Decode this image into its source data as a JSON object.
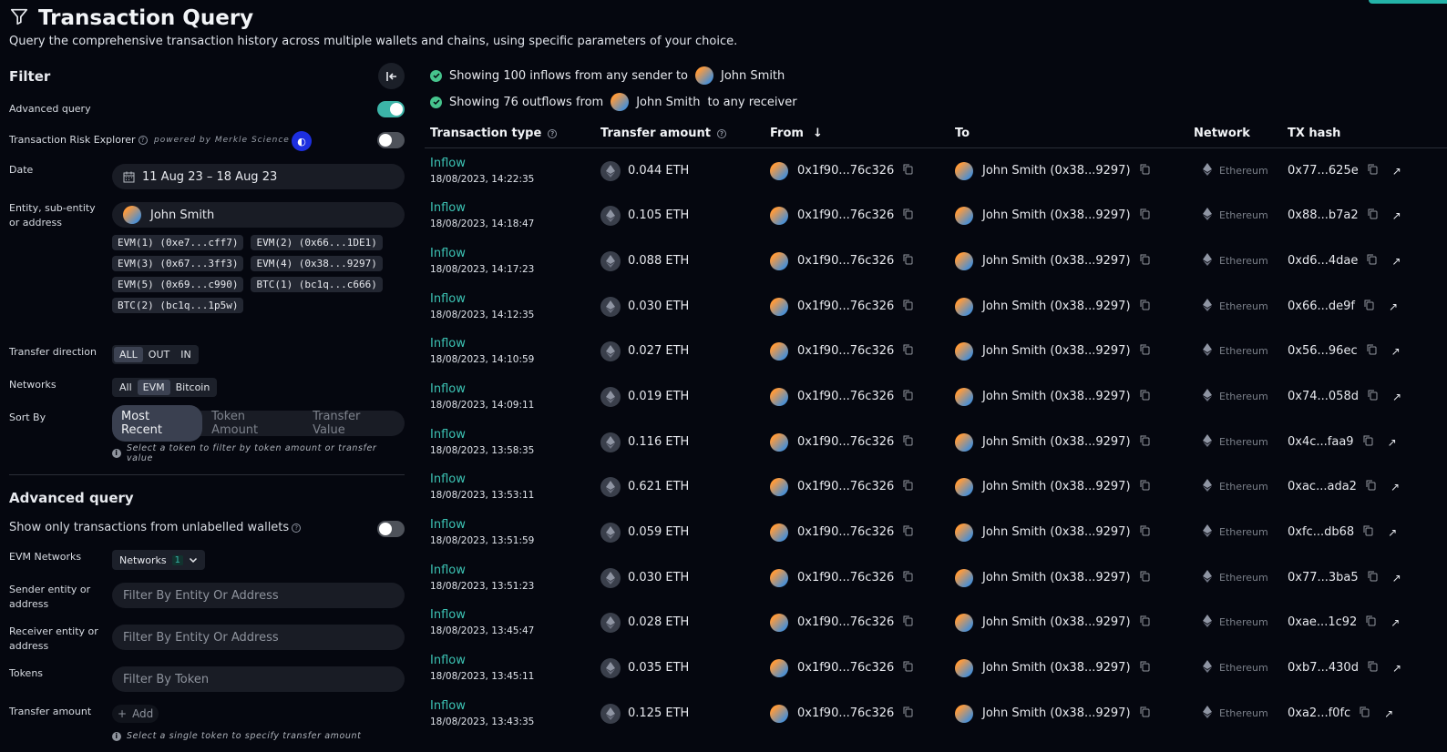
{
  "header": {
    "title": "Transaction Query",
    "subtitle": "Query the comprehensive transaction history across multiple wallets and chains, using specific parameters of your choice."
  },
  "filter": {
    "title": "Filter",
    "advanced_query_label": "Advanced query",
    "advanced_query_on": true,
    "risk_explorer_label": "Transaction Risk Explorer",
    "risk_explorer_on": false,
    "powered_by": "powered by Merkle Science",
    "date_label": "Date",
    "date_value": "11 Aug 23 – 18 Aug 23",
    "entity_label_line1": "Entity, sub-entity",
    "entity_label_line2": "or address",
    "entity_value": "John Smith",
    "chips": [
      "EVM(1) (0xe7...cff7)",
      "EVM(2) (0x66...1DE1)",
      "EVM(3) (0x67...3ff3)",
      "EVM(4) (0x38...9297)",
      "EVM(5) (0x69...c990)",
      "BTC(1) (bc1q...c666)",
      "BTC(2) (bc1q...1p5w)"
    ],
    "direction_label": "Transfer direction",
    "direction_options": [
      "ALL",
      "OUT",
      "IN"
    ],
    "networks_label": "Networks",
    "network_options": [
      "All",
      "EVM",
      "Bitcoin"
    ],
    "sort_label": "Sort By",
    "sort_options": [
      "Most Recent",
      "Token Amount",
      "Transfer Value"
    ],
    "sort_hint": "Select a token to filter by token amount or transfer value"
  },
  "advanced": {
    "title": "Advanced query",
    "unlabelled_label": "Show only transactions from unlabelled wallets",
    "unlabelled_on": false,
    "evm_networks_label": "EVM Networks",
    "networks_select": "Networks",
    "networks_count": "1",
    "sender_label_line1": "Sender entity or",
    "sender_label_line2": "address",
    "sender_placeholder": "Filter By Entity Or Address",
    "receiver_label_line1": "Receiver entity or",
    "receiver_label_line2": "address",
    "receiver_placeholder": "Filter By Entity Or Address",
    "tokens_label": "Tokens",
    "tokens_placeholder": "Filter By Token",
    "amount_label": "Transfer amount",
    "add_label": "Add",
    "amount_hint": "Select a single token to specify transfer amount"
  },
  "summary": {
    "inflows_prefix": "Showing 100 inflows from any sender to",
    "inflows_entity": "John Smith",
    "outflows_prefix": "Showing 76 outflows from",
    "outflows_entity": "John Smith",
    "outflows_suffix": "to any receiver"
  },
  "table": {
    "headers": {
      "type": "Transaction type",
      "amount": "Transfer amount",
      "from": "From",
      "to": "To",
      "network": "Network",
      "hash": "TX hash"
    },
    "rows": [
      {
        "type": "Inflow",
        "time": "18/08/2023, 14:22:35",
        "amount": "0.044 ETH",
        "from": "0x1f90...76c326",
        "to": "John Smith (0x38...9297)",
        "network": "Ethereum",
        "hash": "0x77...625e"
      },
      {
        "type": "Inflow",
        "time": "18/08/2023, 14:18:47",
        "amount": "0.105 ETH",
        "from": "0x1f90...76c326",
        "to": "John Smith (0x38...9297)",
        "network": "Ethereum",
        "hash": "0x88...b7a2"
      },
      {
        "type": "Inflow",
        "time": "18/08/2023, 14:17:23",
        "amount": "0.088 ETH",
        "from": "0x1f90...76c326",
        "to": "John Smith (0x38...9297)",
        "network": "Ethereum",
        "hash": "0xd6...4dae"
      },
      {
        "type": "Inflow",
        "time": "18/08/2023, 14:12:35",
        "amount": "0.030 ETH",
        "from": "0x1f90...76c326",
        "to": "John Smith (0x38...9297)",
        "network": "Ethereum",
        "hash": "0x66...de9f"
      },
      {
        "type": "Inflow",
        "time": "18/08/2023, 14:10:59",
        "amount": "0.027 ETH",
        "from": "0x1f90...76c326",
        "to": "John Smith (0x38...9297)",
        "network": "Ethereum",
        "hash": "0x56...96ec"
      },
      {
        "type": "Inflow",
        "time": "18/08/2023, 14:09:11",
        "amount": "0.019 ETH",
        "from": "0x1f90...76c326",
        "to": "John Smith (0x38...9297)",
        "network": "Ethereum",
        "hash": "0x74...058d"
      },
      {
        "type": "Inflow",
        "time": "18/08/2023, 13:58:35",
        "amount": "0.116 ETH",
        "from": "0x1f90...76c326",
        "to": "John Smith (0x38...9297)",
        "network": "Ethereum",
        "hash": "0x4c...faa9"
      },
      {
        "type": "Inflow",
        "time": "18/08/2023, 13:53:11",
        "amount": "0.621 ETH",
        "from": "0x1f90...76c326",
        "to": "John Smith (0x38...9297)",
        "network": "Ethereum",
        "hash": "0xac...ada2"
      },
      {
        "type": "Inflow",
        "time": "18/08/2023, 13:51:59",
        "amount": "0.059 ETH",
        "from": "0x1f90...76c326",
        "to": "John Smith (0x38...9297)",
        "network": "Ethereum",
        "hash": "0xfc...db68"
      },
      {
        "type": "Inflow",
        "time": "18/08/2023, 13:51:23",
        "amount": "0.030 ETH",
        "from": "0x1f90...76c326",
        "to": "John Smith (0x38...9297)",
        "network": "Ethereum",
        "hash": "0x77...3ba5"
      },
      {
        "type": "Inflow",
        "time": "18/08/2023, 13:45:47",
        "amount": "0.028 ETH",
        "from": "0x1f90...76c326",
        "to": "John Smith (0x38...9297)",
        "network": "Ethereum",
        "hash": "0xae...1c92"
      },
      {
        "type": "Inflow",
        "time": "18/08/2023, 13:45:11",
        "amount": "0.035 ETH",
        "from": "0x1f90...76c326",
        "to": "John Smith (0x38...9297)",
        "network": "Ethereum",
        "hash": "0xb7...430d"
      },
      {
        "type": "Inflow",
        "time": "18/08/2023, 13:43:35",
        "amount": "0.125 ETH",
        "from": "0x1f90...76c326",
        "to": "John Smith (0x38...9297)",
        "network": "Ethereum",
        "hash": "0xa2...f0fc"
      }
    ]
  },
  "colors": {
    "accent": "#3cc3b4",
    "background": "#05070f",
    "success": "#46c48d"
  }
}
